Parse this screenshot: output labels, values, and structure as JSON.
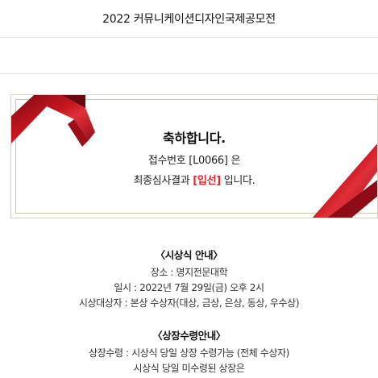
{
  "header": {
    "title": "2022 커뮤니케이션디자인국제공모전"
  },
  "card": {
    "congrats": "축하합니다.",
    "receipt_line": "접수번호 [L0066] 은",
    "result_prefix": "최종심사결과 ",
    "result_value": "[입선]",
    "result_suffix": " 입니다.",
    "ribbon_color": "#b3121c"
  },
  "ceremony": {
    "heading": "〈시상식 안내〉",
    "lines": [
      "장소 : 명지전문대학",
      "일시 : 2022년 7월 29일(금) 오후 2시",
      "시상대상자 : 본상 수상자(대상, 금상, 은상, 동상, 우수상)"
    ]
  },
  "award_receipt": {
    "heading": "〈상장수령안내〉",
    "lines": [
      "상장수령 : 시상식 당일 상장 수령가능 (전체 수상자)",
      "시상식 당일 미수령된 상장은"
    ]
  }
}
